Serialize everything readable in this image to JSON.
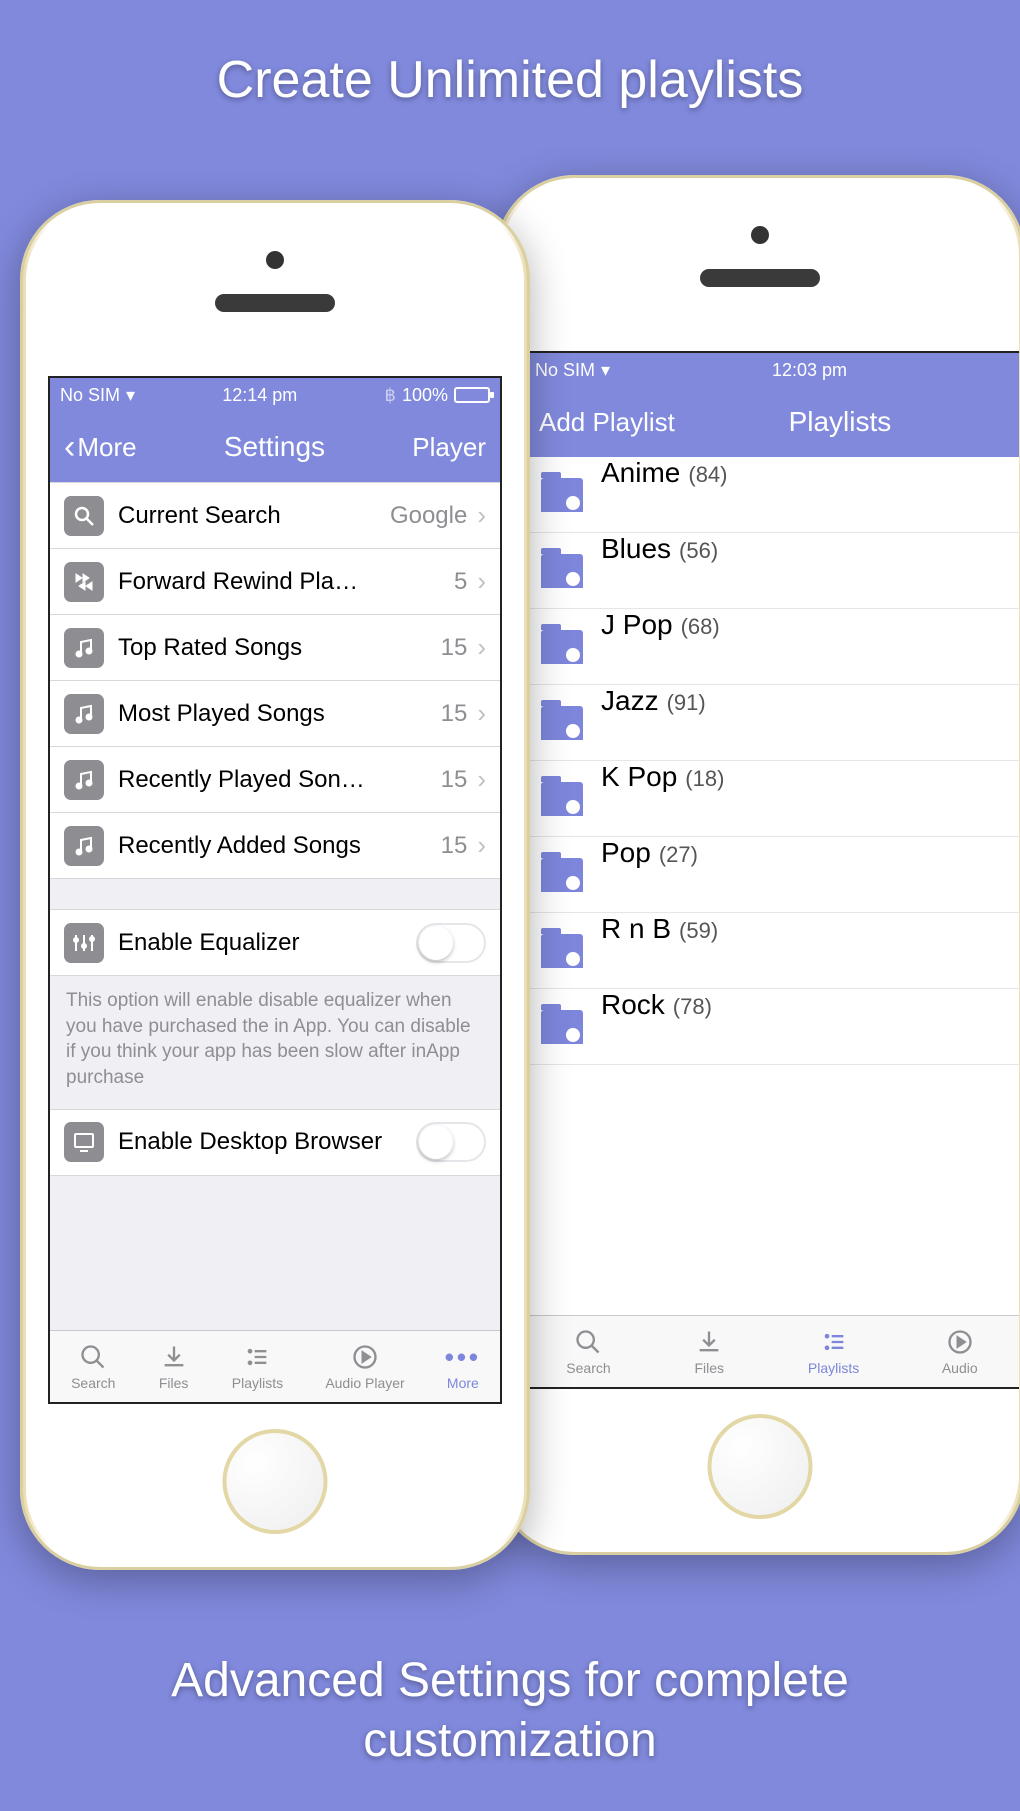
{
  "promo": {
    "headline": "Create Unlimited playlists",
    "footer": "Advanced Settings for complete customization"
  },
  "phone1": {
    "status": {
      "carrier": "No SIM",
      "time": "12:14 pm",
      "battery": "100%"
    },
    "nav": {
      "back": "More",
      "title": "Settings",
      "right": "Player"
    },
    "rows": [
      {
        "icon": "search",
        "label": "Current Search",
        "value": "Google"
      },
      {
        "icon": "ffrw",
        "label": "Forward Rewind Pla…",
        "value": "5"
      },
      {
        "icon": "music",
        "label": "Top Rated Songs",
        "value": "15"
      },
      {
        "icon": "music",
        "label": "Most Played Songs",
        "value": "15"
      },
      {
        "icon": "music",
        "label": "Recently Played Son…",
        "value": "15"
      },
      {
        "icon": "music",
        "label": "Recently Added Songs",
        "value": "15"
      }
    ],
    "eq_row": {
      "label": "Enable Equalizer"
    },
    "eq_note": "This option will enable disable equalizer when you have purchased the in App. You can disable if you think your app has been slow after inApp purchase",
    "desktop_row": {
      "label": "Enable Desktop Browser"
    },
    "tabs": [
      {
        "label": "Search",
        "active": false
      },
      {
        "label": "Files",
        "active": false
      },
      {
        "label": "Playlists",
        "active": false
      },
      {
        "label": "Audio Player",
        "active": false
      },
      {
        "label": "More",
        "active": true
      }
    ]
  },
  "phone2": {
    "status": {
      "carrier": "No SIM",
      "time": "12:03 pm"
    },
    "nav": {
      "left": "Add Playlist",
      "title": "Playlists"
    },
    "playlists": [
      {
        "name": "Anime",
        "count": "(84)"
      },
      {
        "name": "Blues",
        "count": "(56)"
      },
      {
        "name": "J Pop",
        "count": "(68)"
      },
      {
        "name": "Jazz",
        "count": "(91)"
      },
      {
        "name": "K Pop",
        "count": "(18)"
      },
      {
        "name": "Pop",
        "count": "(27)"
      },
      {
        "name": "R n B",
        "count": "(59)"
      },
      {
        "name": "Rock",
        "count": "(78)"
      }
    ],
    "tabs": [
      {
        "label": "Search",
        "active": false
      },
      {
        "label": "Files",
        "active": false
      },
      {
        "label": "Playlists",
        "active": true
      },
      {
        "label": "Audio",
        "active": false
      }
    ]
  }
}
